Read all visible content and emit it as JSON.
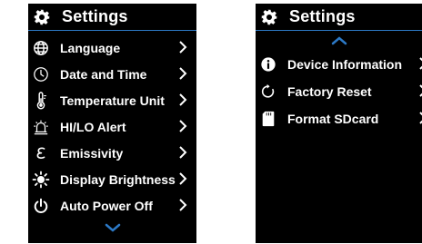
{
  "left_screen": {
    "title": "Settings",
    "items": [
      {
        "label": "Language",
        "icon": "globe-icon"
      },
      {
        "label": "Date and Time",
        "icon": "clock-icon"
      },
      {
        "label": "Temperature Unit",
        "icon": "thermometer-icon"
      },
      {
        "label": "HI/LO Alert",
        "icon": "alarm-icon"
      },
      {
        "label": "Emissivity",
        "icon": "epsilon-icon"
      },
      {
        "label": "Display Brightness",
        "icon": "brightness-icon"
      },
      {
        "label": "Auto Power Off",
        "icon": "power-icon"
      }
    ],
    "scroll": "chevron-down-icon"
  },
  "right_screen": {
    "title": "Settings",
    "scroll": "chevron-up-icon",
    "items": [
      {
        "label": "Device Information",
        "icon": "info-icon"
      },
      {
        "label": "Factory Reset",
        "icon": "reset-icon"
      },
      {
        "label": "Format SDcard",
        "icon": "sdcard-icon"
      }
    ]
  },
  "colors": {
    "accent": "#2c79c6",
    "background": "#000000",
    "text": "#ffffff"
  }
}
